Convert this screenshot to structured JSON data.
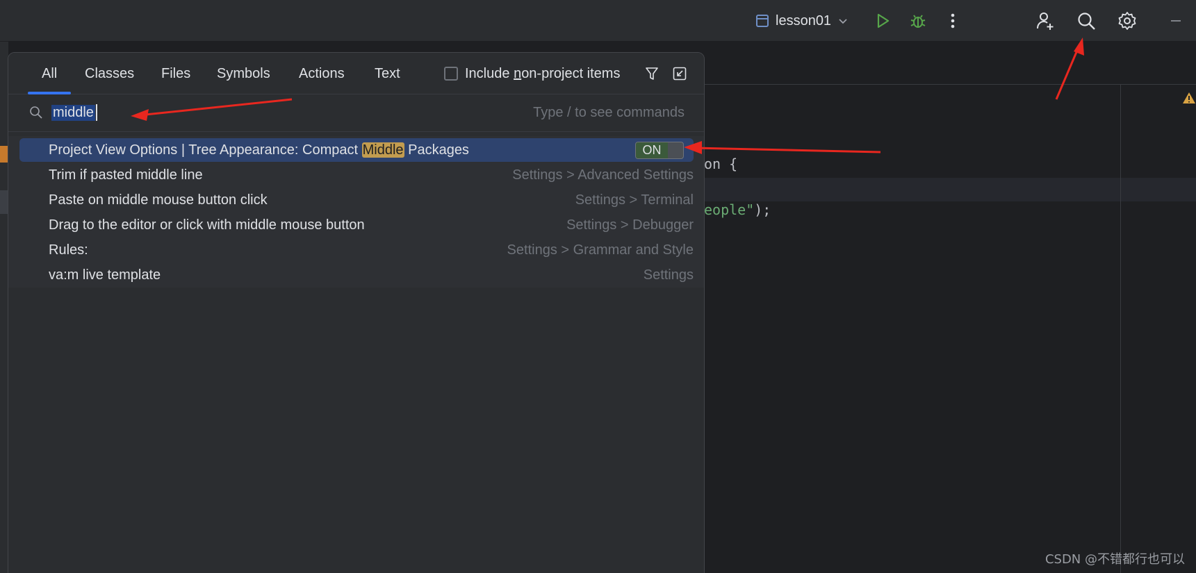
{
  "titlebar": {
    "run_config": "lesson01",
    "icons": [
      "run-icon",
      "debug-icon",
      "more-icon",
      "add-user-icon",
      "search-icon",
      "settings-icon",
      "minimize-icon"
    ]
  },
  "popup": {
    "tabs": [
      {
        "label": "All",
        "active": true
      },
      {
        "label": "Classes",
        "active": false
      },
      {
        "label": "Files",
        "active": false
      },
      {
        "label": "Symbols",
        "active": false
      },
      {
        "label": "Actions",
        "active": false
      },
      {
        "label": "Text",
        "active": false
      }
    ],
    "include_label_pre": "Include ",
    "include_label_u": "n",
    "include_label_post": "on-project items",
    "search": {
      "value": "middle",
      "hint": "Type / to see commands"
    },
    "results": [
      {
        "label_pre": "Project View Options | Tree Appearance: Compact ",
        "label_hl": "Middle",
        "label_post": " Packages",
        "toggle": "ON"
      },
      {
        "label": "Trim if pasted middle line",
        "path": "Settings > Advanced Settings"
      },
      {
        "label": "Paste on middle mouse button click",
        "path": "Settings > Terminal"
      },
      {
        "label": "Drag to the editor or click with middle mouse button",
        "path": "Settings > Debugger"
      },
      {
        "label": "Rules:",
        "path": "Settings > Grammar and Style"
      },
      {
        "label": "va:m live template",
        "path": "Settings"
      }
    ]
  },
  "editor": {
    "line1": "on {",
    "line2_str": "eople\"",
    "line2_end": ");"
  },
  "watermark": "CSDN @不错都行也可以",
  "colors": {
    "accent": "#3574f0",
    "selection": "#2e436e",
    "highlight": "#c29c4f",
    "annotation": "#e8271f"
  }
}
